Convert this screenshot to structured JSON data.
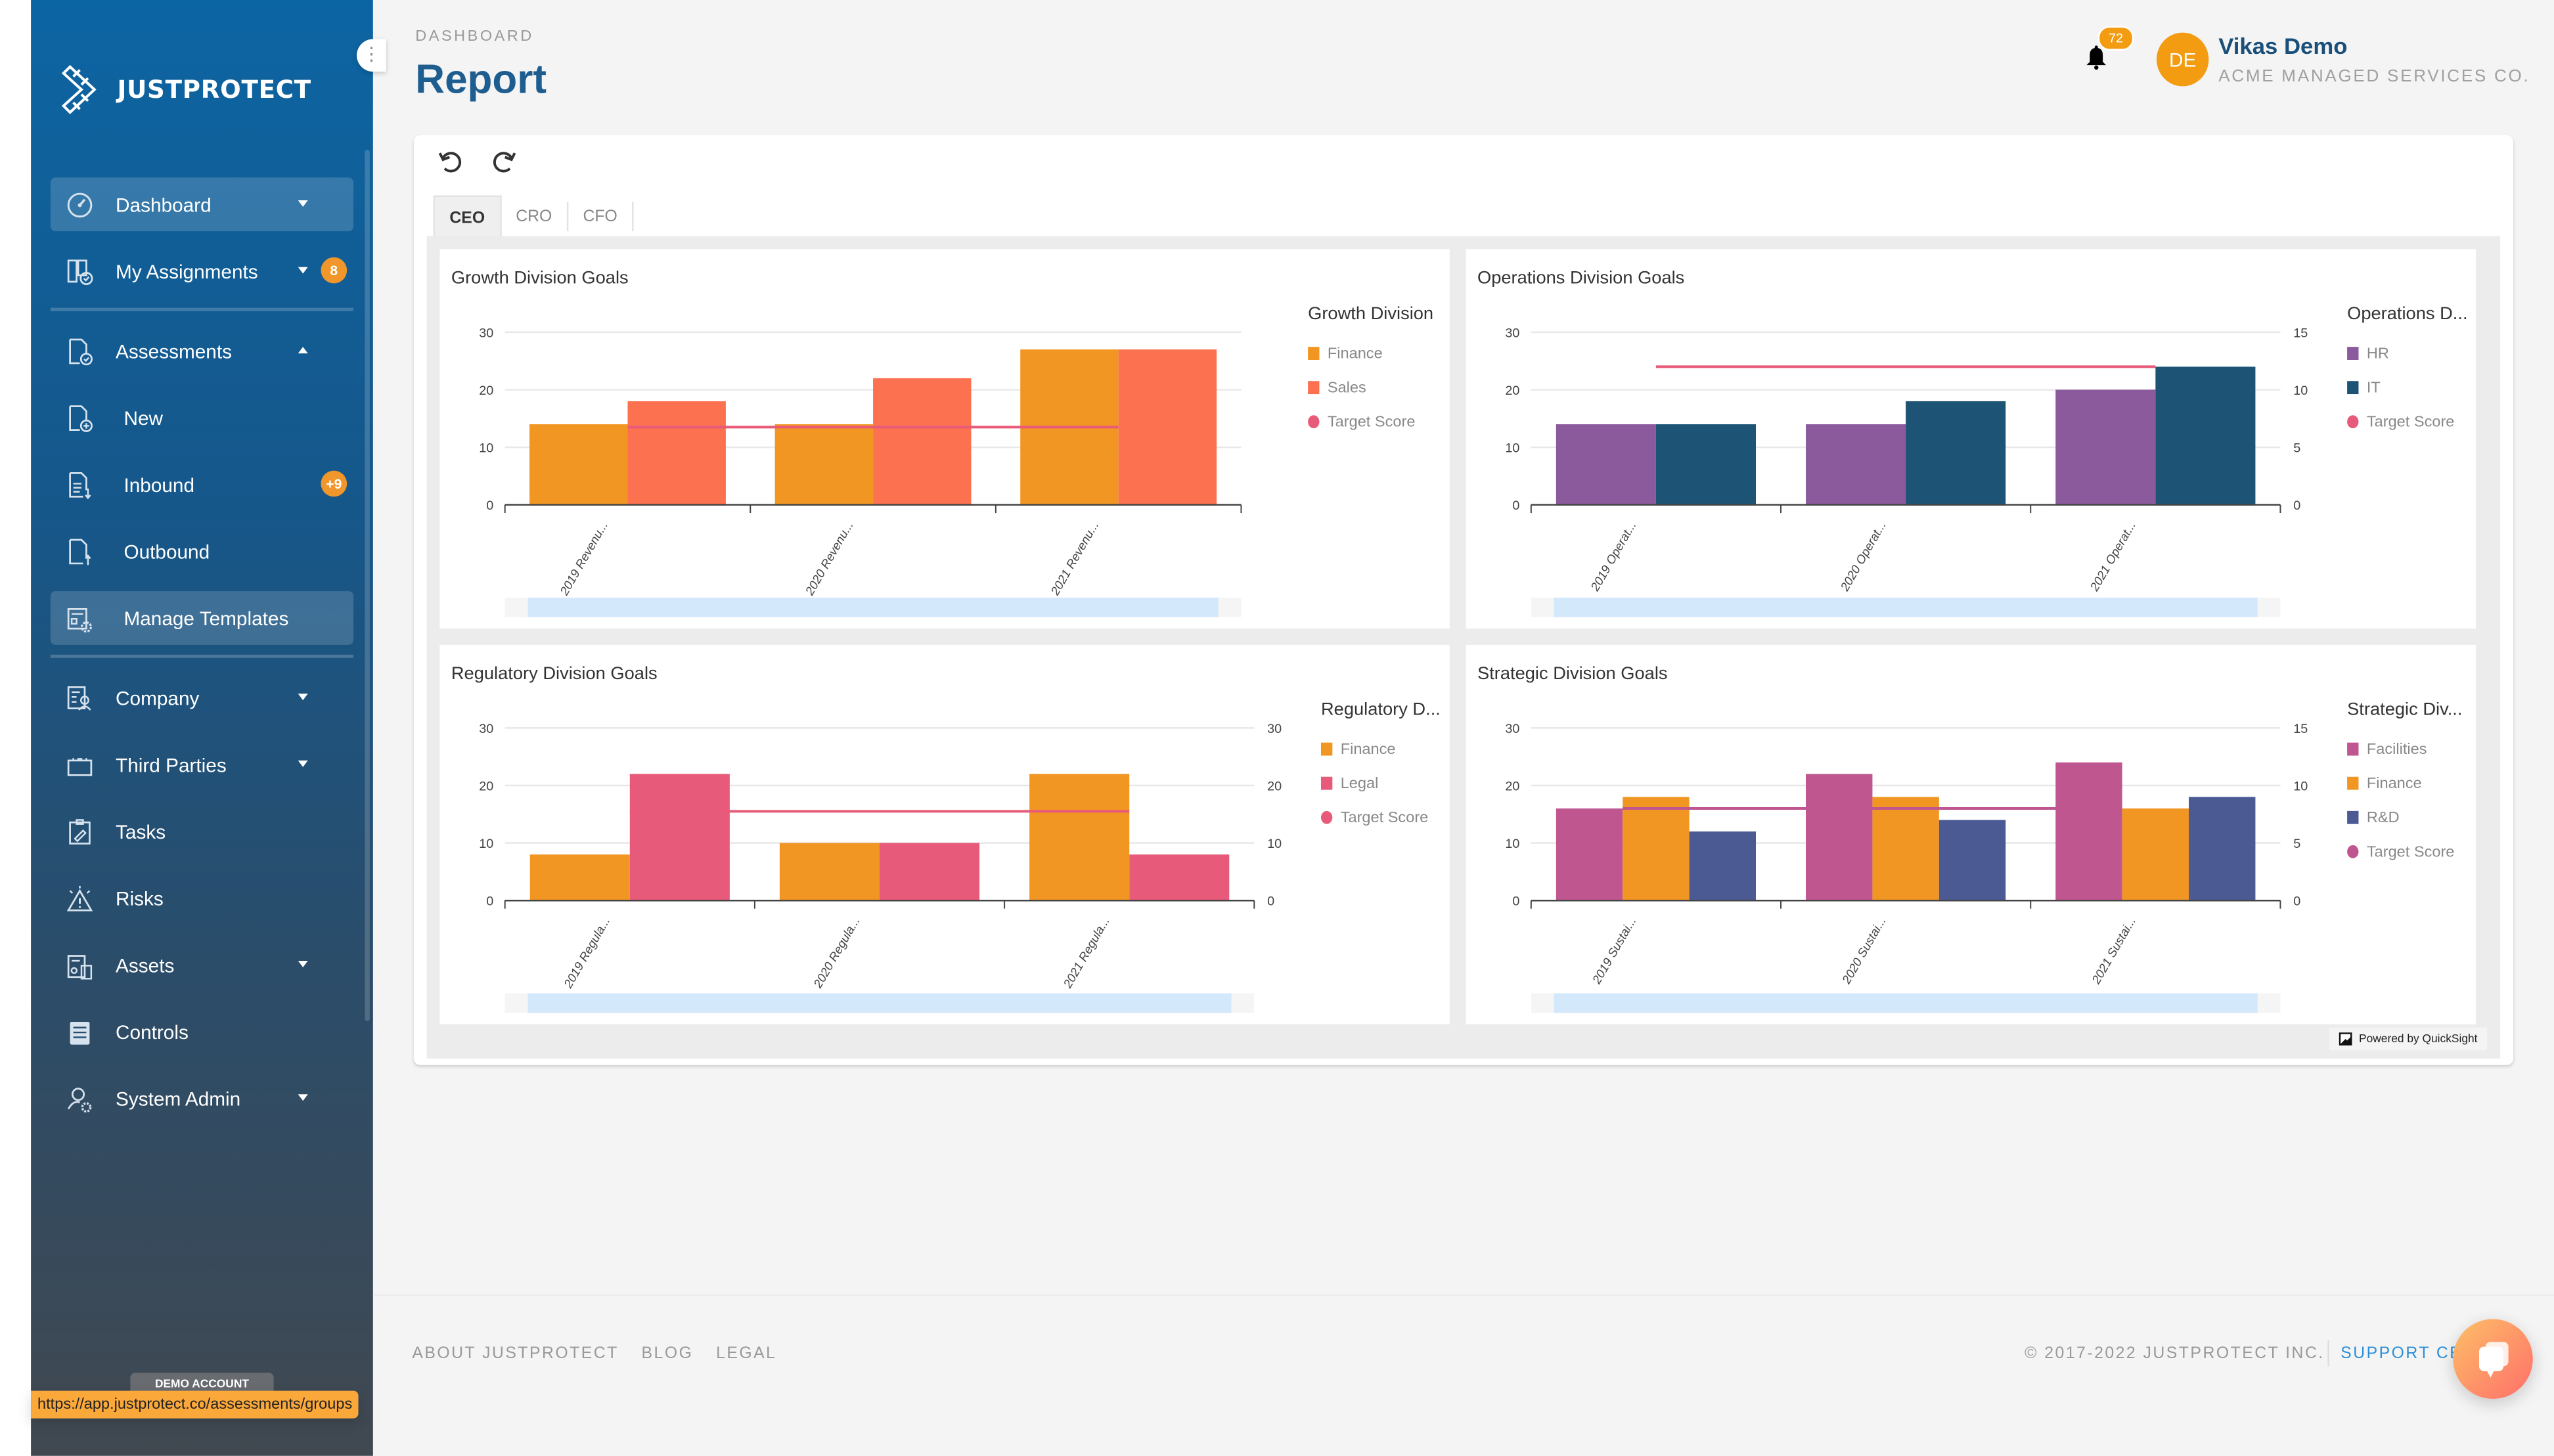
{
  "app": {
    "brand": "JUSTPROTECT",
    "demo_label": "DEMO ACCOUNT",
    "status_url": "https://app.justprotect.co/assessments/groups"
  },
  "sidebar": {
    "items": [
      {
        "label": "Dashboard",
        "icon": "dashboard-gauge-icon",
        "caret": "down",
        "active": true
      },
      {
        "label": "My Assignments",
        "icon": "assignments-icon",
        "caret": "down",
        "badge": "8"
      },
      {
        "label": "Assessments",
        "icon": "assessment-check-icon",
        "caret": "up"
      },
      {
        "label": "New",
        "icon": "document-add-icon",
        "sub": true
      },
      {
        "label": "Inbound",
        "icon": "document-inbound-icon",
        "sub": true,
        "badge": "+9"
      },
      {
        "label": "Outbound",
        "icon": "document-outbound-icon",
        "sub": true
      },
      {
        "label": "Manage Templates",
        "icon": "template-settings-icon",
        "sub": true,
        "active": true
      },
      {
        "label": "Company",
        "icon": "company-icon",
        "caret": "down"
      },
      {
        "label": "Third Parties",
        "icon": "third-parties-icon",
        "caret": "down"
      },
      {
        "label": "Tasks",
        "icon": "tasks-clipboard-icon"
      },
      {
        "label": "Risks",
        "icon": "risk-warning-icon"
      },
      {
        "label": "Assets",
        "icon": "assets-icon",
        "caret": "down"
      },
      {
        "label": "Controls",
        "icon": "controls-list-icon"
      },
      {
        "label": "System Admin",
        "icon": "system-admin-icon",
        "caret": "down"
      }
    ]
  },
  "header": {
    "breadcrumb": "DASHBOARD",
    "title": "Report",
    "notifications_count": "72",
    "user": {
      "initials": "DE",
      "name": "Vikas Demo",
      "org": "ACME MANAGED SERVICES CO."
    }
  },
  "report": {
    "tabs": [
      {
        "label": "CEO",
        "active": true
      },
      {
        "label": "CRO"
      },
      {
        "label": "CFO"
      }
    ],
    "powered_by": "Powered by QuickSight"
  },
  "colors": {
    "finance": "#f29623",
    "sales": "#fc7150",
    "target": "#e85a79",
    "hr": "#8a5a9c",
    "it": "#1d5375",
    "legal": "#e85a79",
    "facilities": "#bf5690",
    "rd": "#4c5a94",
    "strategic_target": "#bf5690"
  },
  "chart_data": [
    {
      "type": "bar",
      "title": "Growth Division Goals",
      "legend_title": "Growth Division",
      "categories": [
        "2019 Revenu...",
        "2020 Revenu...",
        "2021 Revenu..."
      ],
      "series": [
        {
          "name": "Finance",
          "values": [
            14,
            14,
            27
          ],
          "color_key": "finance"
        },
        {
          "name": "Sales",
          "values": [
            18,
            22,
            27
          ],
          "color_key": "sales"
        }
      ],
      "line": {
        "name": "Target Score",
        "values": [
          13.5,
          13.5,
          13.5
        ],
        "color_key": "target",
        "axis": "left"
      },
      "ylim": [
        0,
        30
      ],
      "yticks": [
        0,
        10,
        20,
        30
      ],
      "y2ticks": [],
      "legend": "right",
      "grid": true
    },
    {
      "type": "bar",
      "title": "Operations Division Goals",
      "legend_title": "Operations D...",
      "categories": [
        "2019 Operat...",
        "2020 Operat...",
        "2021 Operat..."
      ],
      "series": [
        {
          "name": "HR",
          "values": [
            14,
            14,
            20
          ],
          "color_key": "hr"
        },
        {
          "name": "IT",
          "values": [
            14,
            18,
            24
          ],
          "color_key": "it"
        }
      ],
      "line": {
        "name": "Target Score",
        "values": [
          12,
          12,
          12
        ],
        "color_key": "target",
        "axis": "right"
      },
      "ylim": [
        0,
        30
      ],
      "y2lim": [
        0,
        15
      ],
      "yticks": [
        0,
        10,
        20,
        30
      ],
      "y2ticks": [
        0,
        5,
        10,
        15
      ],
      "legend": "right",
      "grid": true
    },
    {
      "type": "bar",
      "title": "Regulatory Division Goals",
      "legend_title": "Regulatory D...",
      "categories": [
        "2019 Regula...",
        "2020 Regula...",
        "2021 Regula..."
      ],
      "series": [
        {
          "name": "Finance",
          "values": [
            8,
            10,
            22
          ],
          "color_key": "finance"
        },
        {
          "name": "Legal",
          "values": [
            22,
            10,
            8
          ],
          "color_key": "legal"
        }
      ],
      "line": {
        "name": "Target Score",
        "values": [
          15.5,
          15.5,
          15.5
        ],
        "color_key": "target",
        "axis": "right"
      },
      "ylim": [
        0,
        30
      ],
      "y2lim": [
        0,
        30
      ],
      "yticks": [
        0,
        10,
        20,
        30
      ],
      "y2ticks": [
        0,
        10,
        20,
        30
      ],
      "legend": "right",
      "grid": true
    },
    {
      "type": "bar",
      "title": "Strategic Division Goals",
      "legend_title": "Strategic Div...",
      "categories": [
        "2019 Sustai...",
        "2020 Sustai...",
        "2021 Sustai..."
      ],
      "series": [
        {
          "name": "Facilities",
          "values": [
            16,
            22,
            24
          ],
          "color_key": "facilities"
        },
        {
          "name": "Finance",
          "values": [
            18,
            18,
            16
          ],
          "color_key": "finance"
        },
        {
          "name": "R&D",
          "values": [
            12,
            14,
            18
          ],
          "color_key": "rd"
        }
      ],
      "line": {
        "name": "Target Score",
        "values": [
          8,
          8,
          8
        ],
        "color_key": "strategic_target",
        "axis": "right"
      },
      "ylim": [
        0,
        30
      ],
      "y2lim": [
        0,
        15
      ],
      "yticks": [
        0,
        10,
        20,
        30
      ],
      "y2ticks": [
        0,
        5,
        10,
        15
      ],
      "legend": "right",
      "grid": true
    }
  ],
  "footer": {
    "links": [
      "ABOUT JUSTPROTECT",
      "BLOG",
      "LEGAL"
    ],
    "copyright": "© 2017-2022 JUSTPROTECT INC.",
    "support": "SUPPORT CE"
  }
}
